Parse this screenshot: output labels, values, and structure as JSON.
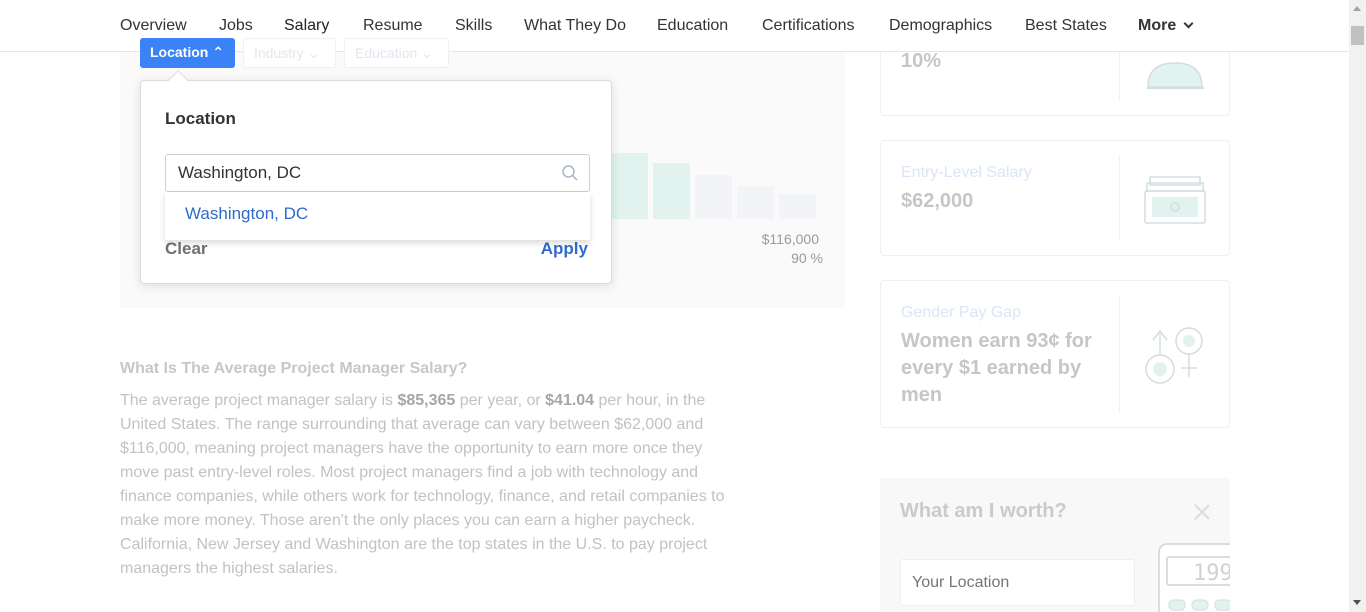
{
  "nav": {
    "items": [
      "Overview",
      "Jobs",
      "Salary",
      "Resume",
      "Skills",
      "What They Do",
      "Education",
      "Certifications",
      "Demographics",
      "Best States"
    ],
    "active": "Salary",
    "more_label": "More"
  },
  "filters": {
    "location": "Location",
    "industry": "Industry",
    "education": "Education"
  },
  "chart": {
    "high_salary": "$116,000",
    "high_percentile": "90 %"
  },
  "popup": {
    "title": "Location",
    "search_value": "Washington, DC",
    "suggestion": "Washington, DC",
    "clear_label": "Clear",
    "apply_label": "Apply"
  },
  "article": {
    "title": "What Is The Average Project Manager Salary?",
    "p1_a": "The average project manager salary is ",
    "p1_salary": "$85,365",
    "p1_b": " per year, or ",
    "p1_hourly": "$41.04",
    "p1_c": " per hour, in the United States. The range surrounding that average can vary between $62,000 and $116,000, meaning project managers have the opportunity to earn more once they move past entry-level roles. Most project managers find a job with technology and finance companies, while others work for technology, finance, and retail companies to make more money. Those aren't the only places you can earn a higher paycheck. California, New Jersey and Washington are the top states in the U.S. to pay project managers the highest salaries."
  },
  "cards": {
    "growth_value": "10%",
    "entry_label": "Entry-Level Salary",
    "entry_value": "$62,000",
    "gap_label": "Gender Pay Gap",
    "gap_value": "Women earn 93¢ for every $1 earned by men"
  },
  "worth": {
    "title": "What am I worth?",
    "location_placeholder": "Your Location",
    "calc_display": "199"
  },
  "colors": {
    "accent": "#3b82f6",
    "link": "#2f6bce",
    "chart_bar": "#e2f3ef"
  }
}
